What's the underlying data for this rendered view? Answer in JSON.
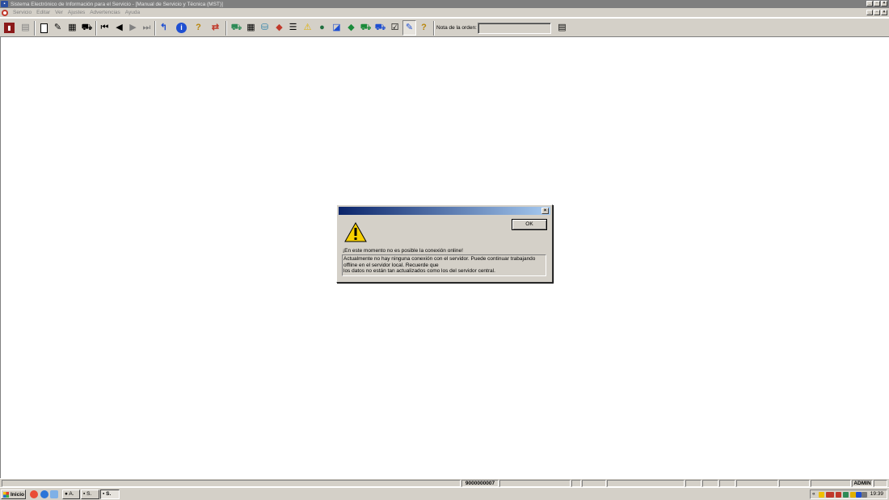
{
  "window": {
    "title": "Sistema Electrónico de Información para el Servicio - [Manual de Servicio y Técnica (MST)]"
  },
  "menu": {
    "items": [
      "Servicio",
      "Editar",
      "Ver",
      "Ajustes",
      "Advertencias",
      "Ayuda"
    ]
  },
  "toolbar": {
    "order_label": "Nota de la orden:",
    "order_value": ""
  },
  "dialog": {
    "ok_label": "OK",
    "headline": "¡En este momento no es posible la conexión online!",
    "message_lines": [
      "Actualmente no hay ninguna conexión con el servidor. Puede continuar trabajando",
      "offline en el servidor local. Recuerde que",
      "los datos no están tan actualizados como los del servidor central."
    ]
  },
  "statusbar": {
    "order_number": "9000000007",
    "user": "ADMIN"
  },
  "taskbar": {
    "start_label": "Inicio",
    "tasks": [
      "A.",
      "S.",
      "S."
    ],
    "clock": "19:39"
  },
  "colors": {
    "titlebar": "#7f7f7f",
    "face": "#d4d0c8",
    "dialog_title_start": "#0a246a",
    "dialog_title_end": "#a6caf0"
  }
}
